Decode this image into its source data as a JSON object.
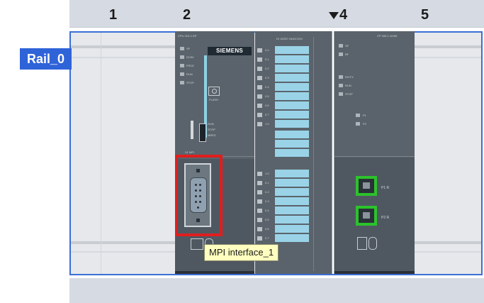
{
  "slot_header": {
    "slots": [
      "1",
      "2",
      "4",
      "5"
    ],
    "caret_icon": "triangle-down-icon"
  },
  "rail": {
    "label": "Rail_0"
  },
  "cpu": {
    "brand": "SIEMENS",
    "model_label": "CPU 315-2 DP",
    "led_labels": [
      "SF",
      "DC5V",
      "FRCE",
      "RUN",
      "STOP"
    ],
    "switch_labels": [
      "RUN",
      "STOP",
      "MRES"
    ],
    "flash_label": "FLASH",
    "port_label": "X1 MPI",
    "port_icon": "dsub-connector-icon"
  },
  "io_module": {
    "model_label": "DI 16/DO 16xDC24V",
    "channel_labels_top": [
      "0.0",
      "0.1",
      "0.2",
      "0.3",
      "0.4",
      "0.5",
      "0.6",
      "0.7",
      "1.0"
    ],
    "channel_labels_bottom": [
      "1.0",
      "0.1",
      "0.2",
      "0.3",
      "0.4",
      "0.5",
      "0.6",
      "0.7"
    ]
  },
  "cp_module": {
    "model_label": "CP 343-1 LEAN",
    "led_labels": [
      "SF",
      "BF",
      "RX/TX",
      "RUN",
      "STOP"
    ],
    "port_led_labels": [
      "P1",
      "P2"
    ],
    "port_labels": [
      "P1 R",
      "P2 R"
    ]
  },
  "tooltip": {
    "text": "MPI interface_1"
  },
  "colors": {
    "selection_blue": "#3a6fd6",
    "highlight_red": "#e01e1e",
    "port_green": "#2cc22c",
    "io_bar_cyan": "#9ad3e8",
    "tooltip_bg": "#ffffc0"
  }
}
